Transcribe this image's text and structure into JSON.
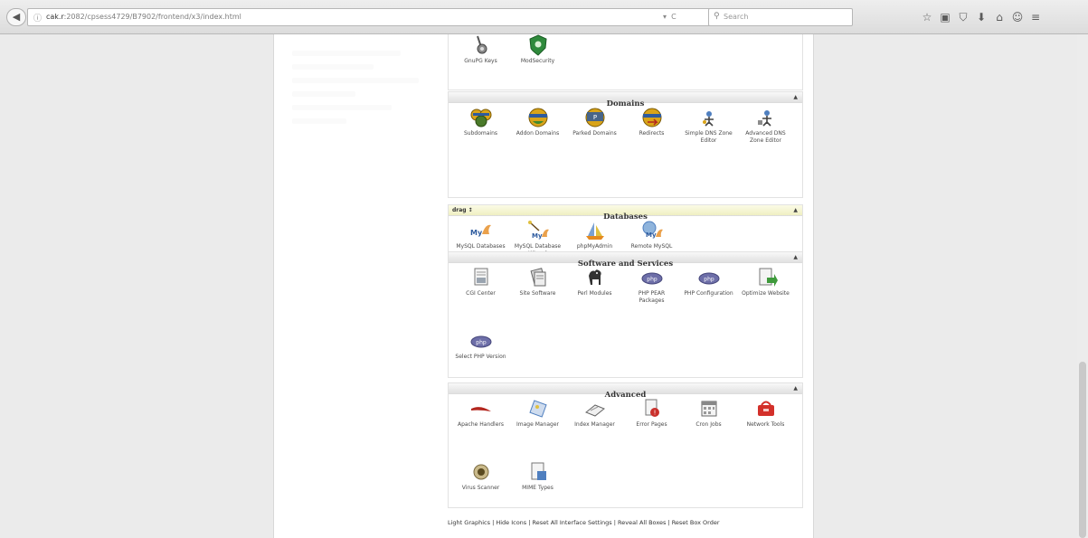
{
  "browser": {
    "url_host": "cak.r",
    "url_rest": ":2082/cpsess4729/B7902/frontend/x3/index.html",
    "search_placeholder": "Search",
    "toolbar_icons": [
      "star-icon",
      "bookmarks-icon",
      "pocket-icon",
      "download-icon",
      "home-icon",
      "sync-icon",
      "menu-icon"
    ],
    "toolbar_glyphs": [
      "☆",
      "▣",
      "⛉",
      "⬇",
      "⌂",
      "☺",
      "≡"
    ]
  },
  "security": {
    "items": [
      {
        "label": "GnuPG Keys",
        "icon": "gnupg-key-icon"
      },
      {
        "label": "ModSecurity",
        "icon": "modsecurity-shield-icon"
      }
    ]
  },
  "domains": {
    "title": "Domains",
    "items": [
      {
        "label": "Subdomains",
        "icon": "subdomains-icon"
      },
      {
        "label": "Addon Domains",
        "icon": "addon-domains-icon"
      },
      {
        "label": "Parked Domains",
        "icon": "parked-domains-icon"
      },
      {
        "label": "Redirects",
        "icon": "redirects-icon"
      },
      {
        "label": "Simple DNS Zone Editor",
        "icon": "simple-dns-zone-editor-icon"
      },
      {
        "label": "Advanced DNS Zone Editor",
        "icon": "advanced-dns-zone-editor-icon"
      }
    ]
  },
  "databases": {
    "title": "Databases",
    "drag_label": "drag ↕",
    "items": [
      {
        "label": "MySQL Databases",
        "icon": "mysql-databases-icon"
      },
      {
        "label": "MySQL Database Wizard",
        "icon": "mysql-wizard-icon"
      },
      {
        "label": "phpMyAdmin",
        "icon": "phpmyadmin-icon"
      },
      {
        "label": "Remote MySQL",
        "icon": "remote-mysql-icon"
      }
    ]
  },
  "software": {
    "title": "Software and Services",
    "items": [
      {
        "label": "CGI Center",
        "icon": "cgi-center-icon"
      },
      {
        "label": "Site Software",
        "icon": "site-software-icon"
      },
      {
        "label": "Perl Modules",
        "icon": "perl-modules-icon"
      },
      {
        "label": "PHP PEAR Packages",
        "icon": "php-pear-icon"
      },
      {
        "label": "PHP Configuration",
        "icon": "php-configuration-icon"
      },
      {
        "label": "Optimize Website",
        "icon": "optimize-website-icon"
      },
      {
        "label": "Select PHP Version",
        "icon": "select-php-version-icon"
      }
    ]
  },
  "advanced": {
    "title": "Advanced",
    "items": [
      {
        "label": "Apache Handlers",
        "icon": "apache-handlers-icon"
      },
      {
        "label": "Image Manager",
        "icon": "image-manager-icon"
      },
      {
        "label": "Index Manager",
        "icon": "index-manager-icon"
      },
      {
        "label": "Error Pages",
        "icon": "error-pages-icon"
      },
      {
        "label": "Cron Jobs",
        "icon": "cron-jobs-icon"
      },
      {
        "label": "Network Tools",
        "icon": "network-tools-icon"
      },
      {
        "label": "Virus Scanner",
        "icon": "virus-scanner-icon"
      },
      {
        "label": "MIME Types",
        "icon": "mime-types-icon"
      }
    ]
  },
  "footer": {
    "links": [
      "Light Graphics",
      "Hide Icons",
      "Reset All Interface Settings",
      "Reveal All Boxes",
      "Reset Box Order"
    ],
    "separator": " | "
  },
  "colors": {
    "php_purple": "#6d6ea8",
    "shield_green": "#2f8a3c",
    "globe_gold": "#d9a419",
    "apache_red": "#b3261e",
    "highlight_yellow": "#f2f2c6"
  }
}
